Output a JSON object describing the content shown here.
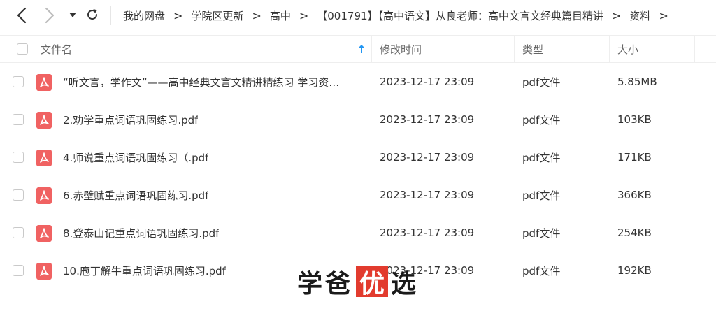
{
  "breadcrumb": [
    "我的网盘",
    "学院区更新",
    "高中",
    "【001791】【高中语文】从良老师：高中文言文经典篇目精讲",
    "资料"
  ],
  "breadcrumb_separator": ">",
  "columns": {
    "name": "文件名",
    "modified": "修改时间",
    "type": "类型",
    "size": "大小"
  },
  "files": [
    {
      "name": "“听文言，学作文”——高中经典文言文精讲精练习 学习资…",
      "modified": "2023-12-17 23:09",
      "type": "pdf文件",
      "size": "5.85MB"
    },
    {
      "name": "2.劝学重点词语巩固练习.pdf",
      "modified": "2023-12-17 23:09",
      "type": "pdf文件",
      "size": "103KB"
    },
    {
      "name": "4.师说重点词语巩固练习（.pdf",
      "modified": "2023-12-17 23:09",
      "type": "pdf文件",
      "size": "171KB"
    },
    {
      "name": "6.赤壁赋重点词语巩固练习.pdf",
      "modified": "2023-12-17 23:09",
      "type": "pdf文件",
      "size": "366KB"
    },
    {
      "name": "8.登泰山记重点词语巩固练习.pdf",
      "modified": "2023-12-17 23:09",
      "type": "pdf文件",
      "size": "254KB"
    },
    {
      "name": "10.庖丁解牛重点词语巩固练习.pdf",
      "modified": "2023-12-17 23:09",
      "type": "pdf文件",
      "size": "192KB"
    }
  ],
  "watermark": {
    "part1": "学爸",
    "boxed": "优",
    "part2": "选"
  },
  "colors": {
    "pdf_icon": "#f06262",
    "sort_arrow": "#2196f3",
    "watermark_box": "#e23b2e"
  },
  "icons": {
    "back": "chevron-left-icon",
    "forward": "chevron-right-icon",
    "dropdown": "caret-down-icon",
    "refresh": "refresh-icon",
    "sort": "sort-up-arrow-icon",
    "file": "pdf-file-icon"
  }
}
